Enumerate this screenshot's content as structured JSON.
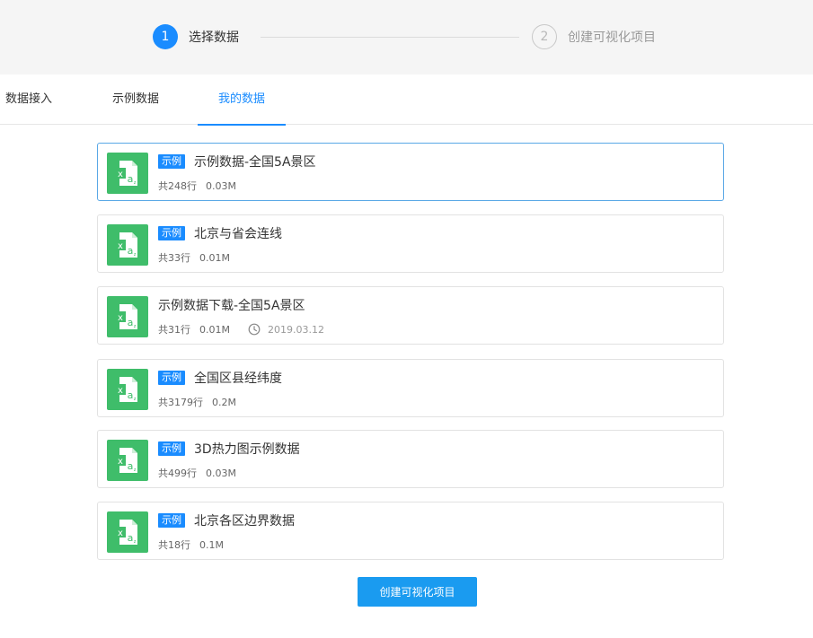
{
  "stepper": {
    "steps": [
      {
        "number": "1",
        "label": "选择数据",
        "status": "active"
      },
      {
        "number": "2",
        "label": "创建可视化项目",
        "status": "inactive"
      }
    ]
  },
  "tabs": [
    {
      "label": "数据接入",
      "active": false
    },
    {
      "label": "示例数据",
      "active": false
    },
    {
      "label": "我的数据",
      "active": true
    }
  ],
  "datasets": [
    {
      "badge": "示例",
      "title": "示例数据-全国5A景区",
      "rows": "共248行",
      "size": "0.03M",
      "selected": true
    },
    {
      "badge": "示例",
      "title": "北京与省会连线",
      "rows": "共33行",
      "size": "0.01M",
      "selected": false
    },
    {
      "badge": "",
      "title": "示例数据下载-全国5A景区",
      "rows": "共31行",
      "size": "0.01M",
      "date": "2019.03.12",
      "selected": false
    },
    {
      "badge": "示例",
      "title": "全国区县经纬度",
      "rows": "共3179行",
      "size": "0.2M",
      "selected": false
    },
    {
      "badge": "示例",
      "title": "3D热力图示例数据",
      "rows": "共499行",
      "size": "0.03M",
      "selected": false
    },
    {
      "badge": "示例",
      "title": "北京各区边界数据",
      "rows": "共18行",
      "size": "0.1M",
      "selected": false
    }
  ],
  "create_button": {
    "label": "创建可视化项目"
  },
  "colors": {
    "accent": "#1a8cff",
    "file_icon": "#3fbd6a",
    "selected_border": "#5aa8e6"
  }
}
